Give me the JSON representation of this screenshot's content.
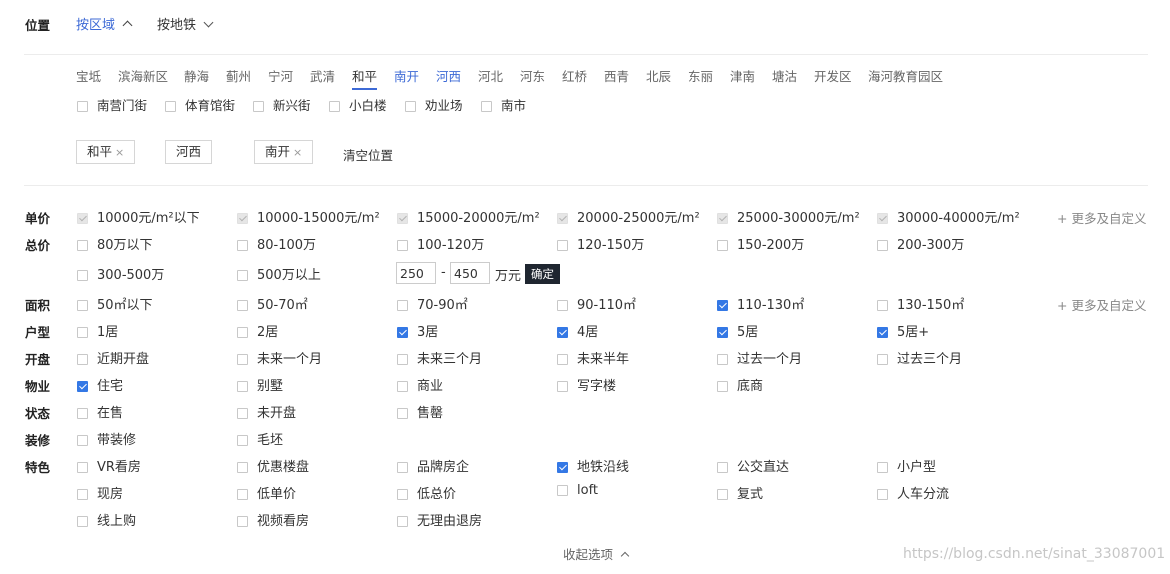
{
  "location": {
    "label": "位置",
    "tabs": [
      "按区域",
      "按地铁"
    ],
    "districts": [
      "宝坻",
      "滨海新区",
      "静海",
      "蓟州",
      "宁河",
      "武清",
      "和平",
      "南开",
      "河西",
      "河北",
      "河东",
      "红桥",
      "西青",
      "北辰",
      "东丽",
      "津南",
      "塘沽",
      "开发区",
      "海河教育园区"
    ],
    "streets": [
      "南营门街",
      "体育馆街",
      "新兴街",
      "小白楼",
      "劝业场",
      "南市"
    ],
    "selected_tags": [
      "和平",
      "河西",
      "南开"
    ],
    "tag_close": "×",
    "clear_label": "清空位置"
  },
  "filters": {
    "unit_price": {
      "label": "单价",
      "options": [
        "10000元/m²以下",
        "10000-15000元/m²",
        "15000-20000元/m²",
        "20000-25000元/m²",
        "25000-30000元/m²",
        "30000-40000元/m²"
      ],
      "more": "+ 更多及自定义"
    },
    "total_price": {
      "label": "总价",
      "options": [
        "80万以下",
        "80-100万",
        "100-120万",
        "120-150万",
        "150-200万",
        "200-300万",
        "300-500万",
        "500万以上"
      ],
      "min_value": "250",
      "dash": "-",
      "max_value": "450",
      "unit": "万元",
      "confirm": "确定"
    },
    "area": {
      "label": "面积",
      "options": [
        "50㎡以下",
        "50-70㎡",
        "70-90㎡",
        "90-110㎡",
        "110-130㎡",
        "130-150㎡"
      ],
      "more": "+ 更多及自定义"
    },
    "layout": {
      "label": "户型",
      "options": [
        "1居",
        "2居",
        "3居",
        "4居",
        "5居",
        "5居+"
      ]
    },
    "opening": {
      "label": "开盘",
      "options": [
        "近期开盘",
        "未来一个月",
        "未来三个月",
        "未来半年",
        "过去一个月",
        "过去三个月"
      ]
    },
    "property": {
      "label": "物业",
      "options": [
        "住宅",
        "别墅",
        "商业",
        "写字楼",
        "底商"
      ]
    },
    "status": {
      "label": "状态",
      "options": [
        "在售",
        "未开盘",
        "售罄"
      ]
    },
    "decoration": {
      "label": "装修",
      "options": [
        "带装修",
        "毛坯"
      ]
    },
    "feature": {
      "label": "特色",
      "options": [
        "VR看房",
        "优惠楼盘",
        "品牌房企",
        "地铁沿线",
        "公交直达",
        "小户型",
        "现房",
        "低单价",
        "低总价",
        "loft",
        "复式",
        "人车分流",
        "线上购",
        "视频看房",
        "无理由退房"
      ]
    }
  },
  "collapse_label": "收起选项",
  "watermark": "https://blog.csdn.net/sinat_33087001",
  "colors": {
    "accent": "#3d6ad6",
    "checkbox": "#3478e5",
    "confirm_bg": "#1f2630"
  }
}
